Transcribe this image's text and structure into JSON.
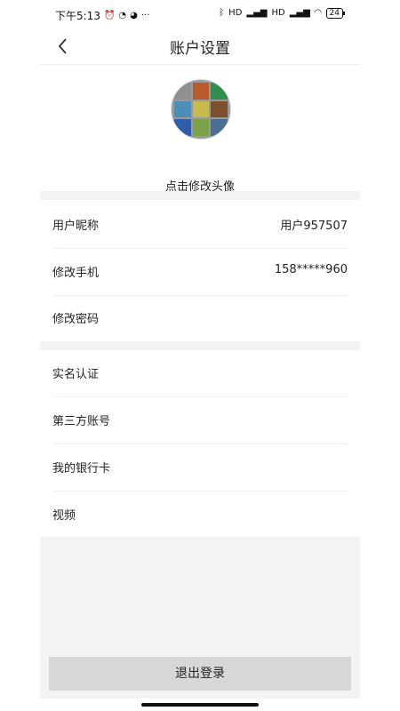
{
  "status_bar": {
    "time": "下午5:13",
    "battery": "24",
    "network_1": "HD",
    "network_2": "HD",
    "more": "···"
  },
  "header": {
    "title": "账户设置"
  },
  "avatar": {
    "label": "点击修改头像",
    "tile_colors": [
      "#8f8f8f",
      "#b85b2e",
      "#2f8f4f",
      "#4d8eb8",
      "#c7b94d",
      "#7d4f2e",
      "#2f5ea8",
      "#7ba24b",
      "#4b6f93"
    ]
  },
  "settings": {
    "section_1": [
      {
        "label": "用户昵称",
        "value": "用户957507"
      },
      {
        "label": "修改手机",
        "value": "158*****960"
      },
      {
        "label": "修改密码",
        "value": ""
      }
    ],
    "section_2": [
      {
        "label": "实名认证"
      },
      {
        "label": "第三方账号"
      },
      {
        "label": "我的银行卡"
      },
      {
        "label": "视频"
      }
    ]
  },
  "actions": {
    "logout_label": "退出登录"
  }
}
